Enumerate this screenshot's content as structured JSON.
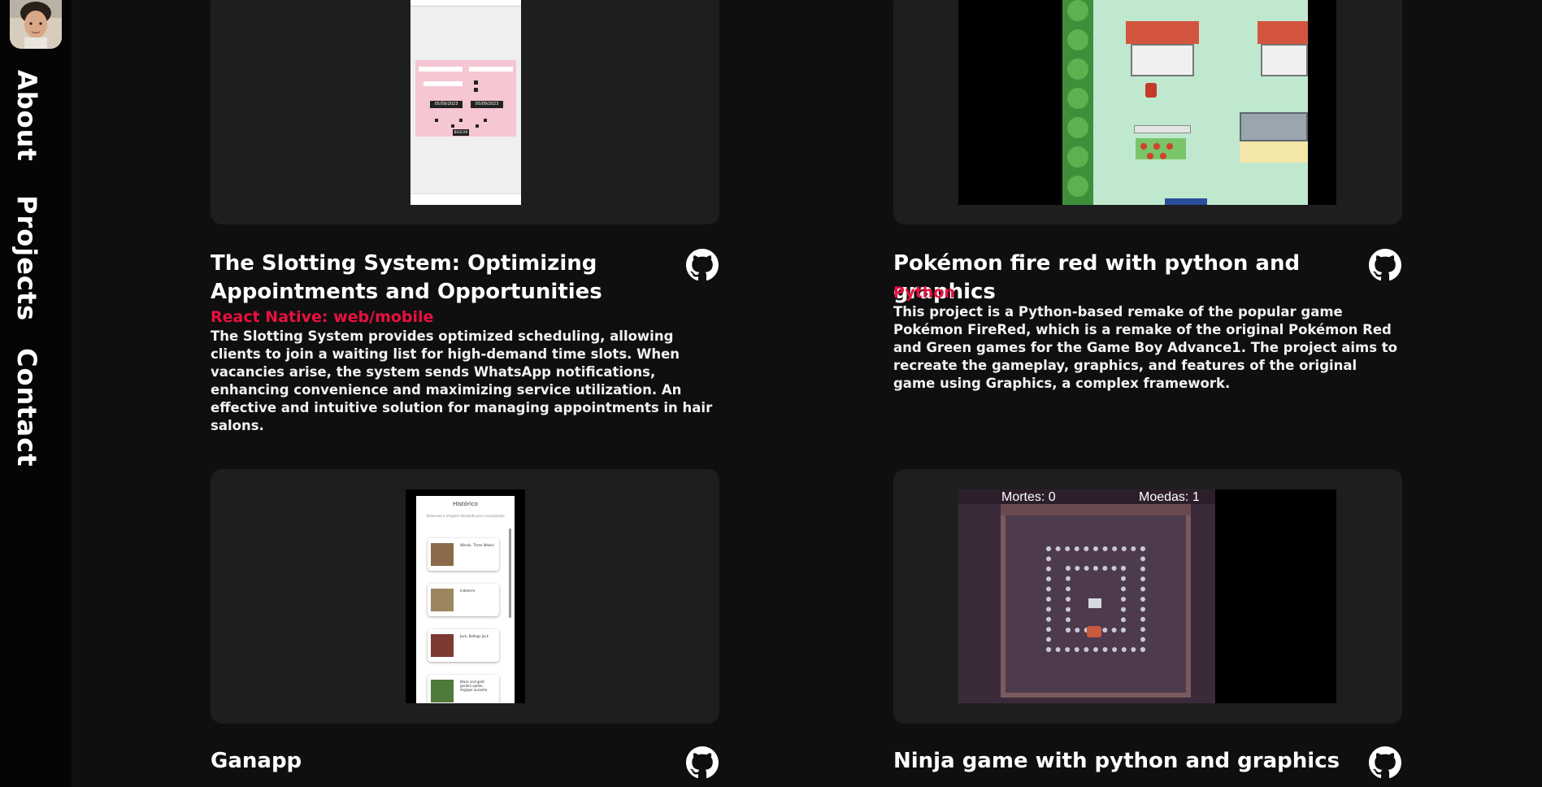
{
  "nav": {
    "about": "About",
    "projects": "Projects",
    "contact": "Contact"
  },
  "projects": [
    {
      "title": "The Slotting System: Optimizing Appointments and Opportunities",
      "tech": "React Native: web/mobile",
      "description": "The Slotting System provides optimized scheduling, allowing clients to join a waiting list for high-demand time slots. When vacancies arise, the system sends WhatsApp notifications, enhancing convenience and maximizing service utilization. An effective and intuitive solution for managing appointments in hair salons.",
      "preview": {
        "dates": [
          "05/09/2023",
          "05/09/2023"
        ],
        "days": [
          "Segunda",
          "Quarta",
          "Quinta",
          "Sexta",
          "Sábado"
        ],
        "button": "BUSCAR"
      }
    },
    {
      "title": "Pokémon fire red with python and graphics",
      "tech": "Python",
      "description": "This project is a Python-based remake of the popular game Pokémon FireRed, which is a remake of the original Pokémon Red and Green games for the Game Boy Advance1. The project aims to recreate the gameplay, graphics, and features of the original game using Graphics, a complex framework."
    },
    {
      "title": "Ganapp",
      "preview": {
        "header": "Histórico",
        "subheader": "Selecione a imagem desejada para visualização",
        "items": [
          "Winnik, Three Weeks",
          "Indeterm",
          "Jack, Rotlegs Jack",
          "Black and gold garden spider, Argiope aurantia"
        ]
      }
    },
    {
      "title": "Ninja game with python and graphics",
      "preview": {
        "deaths": "Mortes: 0",
        "coins": "Moedas: 1"
      }
    }
  ],
  "colors": {
    "accent": "#e8103f",
    "background": "#0f0f10",
    "card": "#1e1e1f",
    "sidebar": "#050505"
  }
}
